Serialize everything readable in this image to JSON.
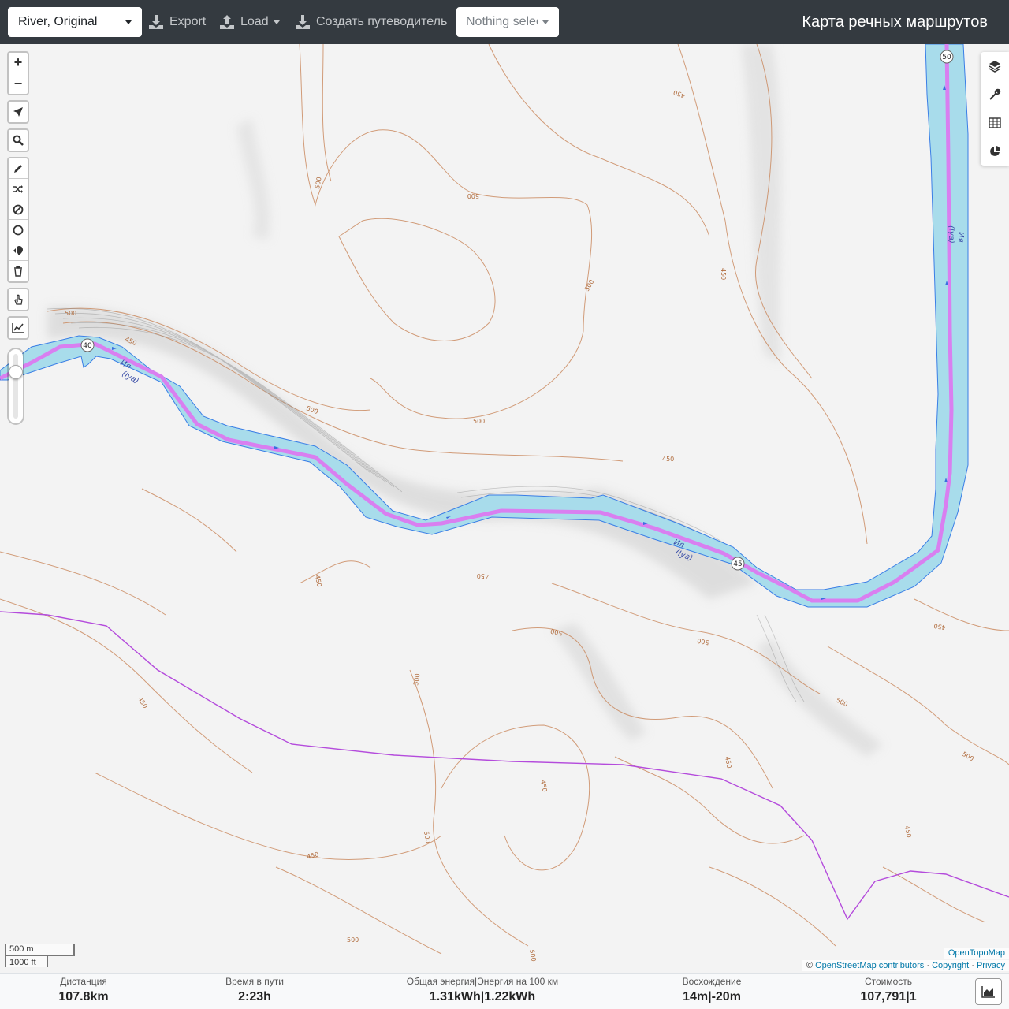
{
  "header": {
    "profile": "River, Original",
    "export_label": "Export",
    "load_label": "Load",
    "guide_label": "Создать путеводитель",
    "selection_placeholder": "Nothing selected",
    "brand": "Карта речных маршрутов"
  },
  "map": {
    "contour_labels": [
      "500",
      "450"
    ],
    "river_label": "Ия",
    "river_label_latin": "(Iya)",
    "km_markers": [
      "40",
      "45",
      "50"
    ],
    "colors": {
      "river_fill": "#a8dceb",
      "river_edge": "#3a7ee6",
      "route": "#d97ff0",
      "contour": "#c9865a",
      "other_line": "#b44bdc"
    }
  },
  "scale": {
    "metric": "500 m",
    "imperial": "1000 ft"
  },
  "attribution": {
    "topo": "OpenTopoMap",
    "copy_symbol": "©",
    "osm": "OpenStreetMap contributors",
    "sep1": "·",
    "copyright": "Copyright",
    "sep2": "·",
    "privacy": "Privacy"
  },
  "stats": {
    "distance": {
      "label": "Дистанция",
      "value": "107.8",
      "unit": "km"
    },
    "time": {
      "label": "Время в пути",
      "value": "2:23",
      "unit": "h"
    },
    "energy": {
      "label": "Общая энергия|Энергия на 100 км",
      "value1": "1.31",
      "unit1": "kWh",
      "sep": "|",
      "value2": "1.22",
      "unit2": "kWh"
    },
    "ascent": {
      "label": "Восхождение",
      "value1": "14",
      "unit1": "m",
      "sep": "|",
      "value2": "-20",
      "unit2": "m"
    },
    "cost": {
      "label": "Стоимость",
      "value": "107,791",
      "sep": "|",
      "value2": "1"
    }
  }
}
